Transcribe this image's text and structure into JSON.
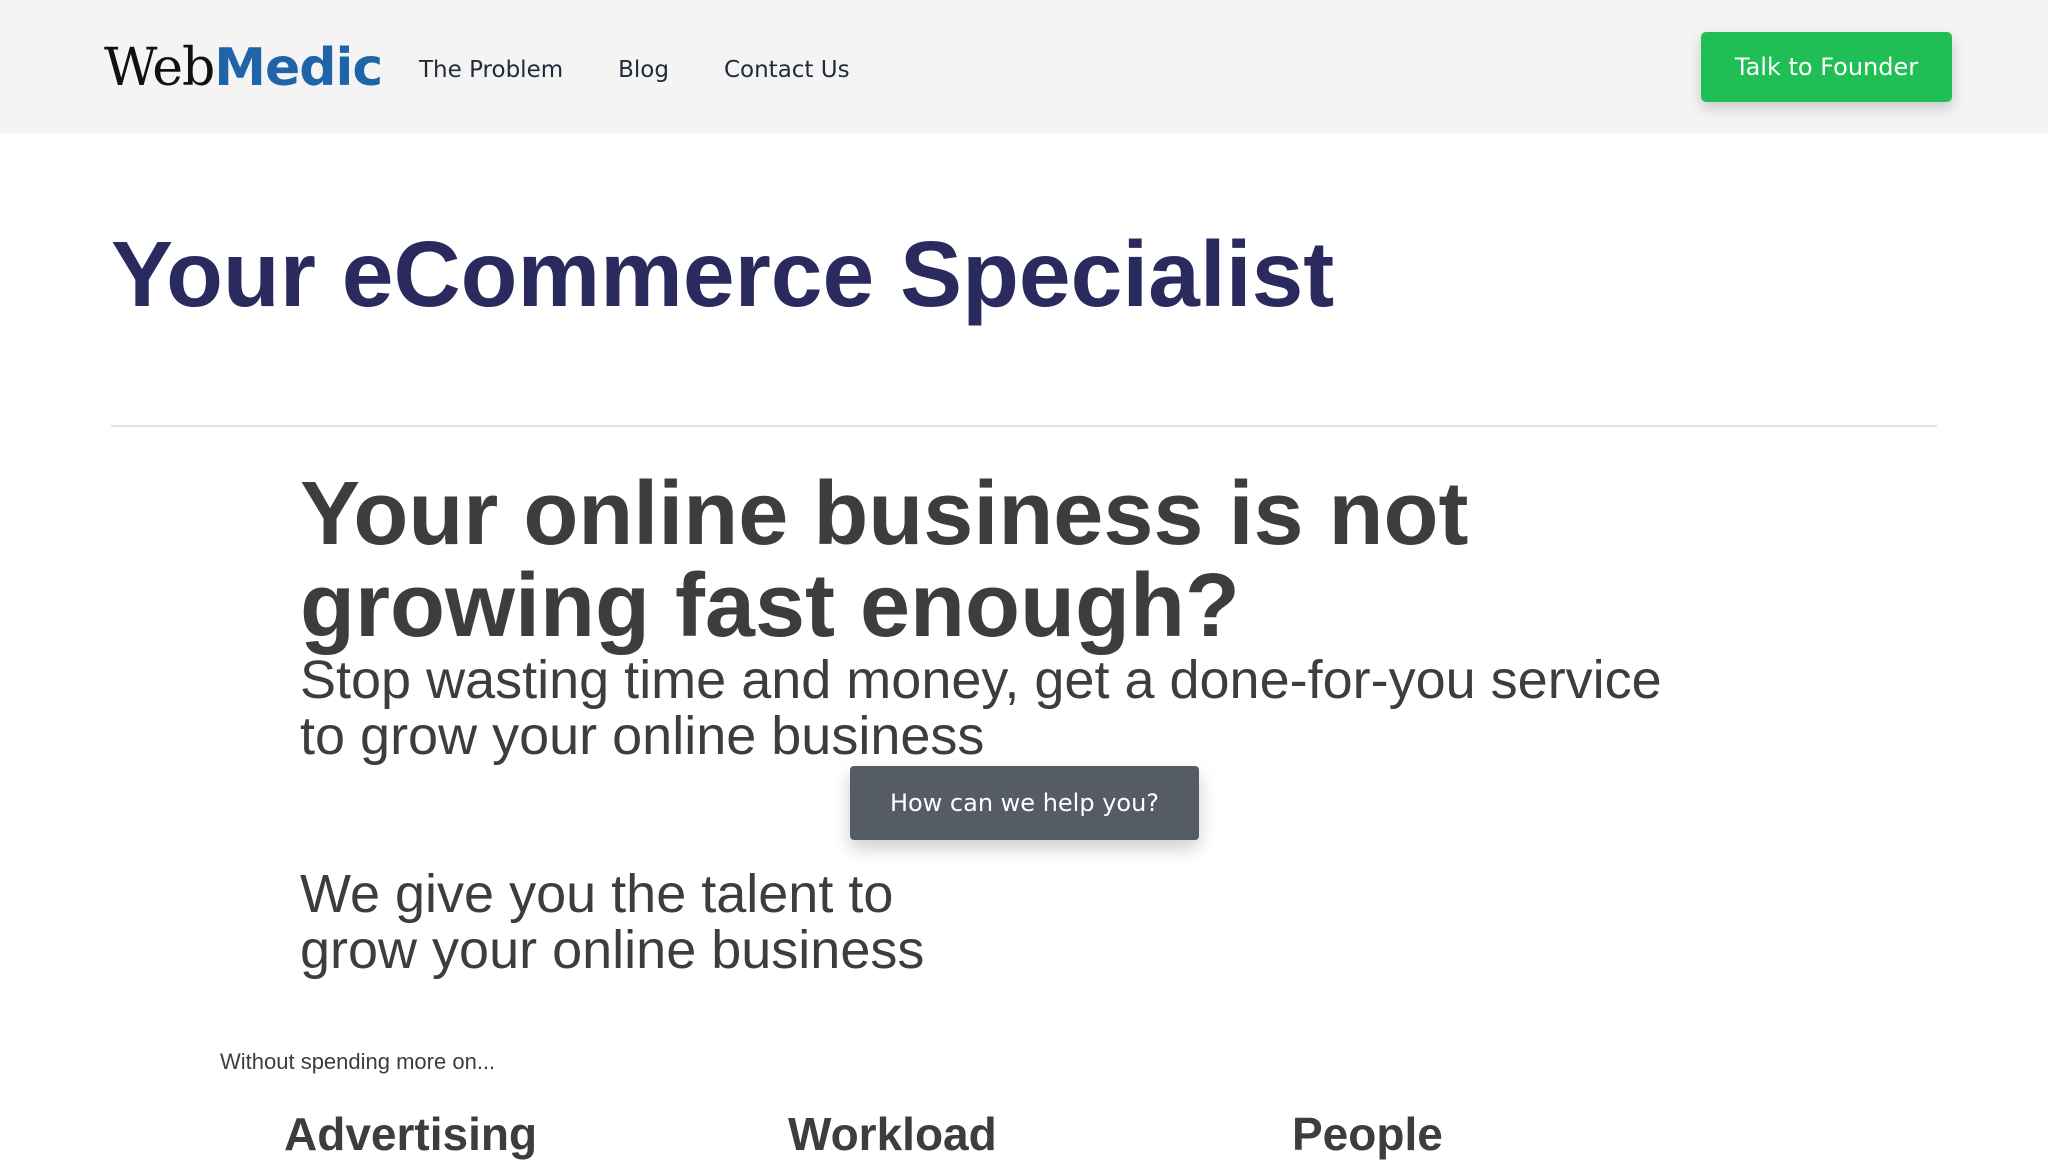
{
  "header": {
    "logo_part1": "Web",
    "logo_part2": "Medic",
    "nav": [
      {
        "label": "The Problem"
      },
      {
        "label": "Blog"
      },
      {
        "label": "Contact Us"
      }
    ],
    "cta_label": "Talk to Founder"
  },
  "hero": {
    "title": "Your eCommerce Specialist"
  },
  "problem": {
    "heading": "Your online business is not growing fast enough?",
    "subheading": "Stop wasting time and money, get a done-for-you service to grow your online business",
    "help_button": "How can we help you?"
  },
  "talent": {
    "line1": "We give you the talent to",
    "line2": "grow your online business"
  },
  "without": {
    "label": "Without spending more on...",
    "items": [
      {
        "label": "Advertising"
      },
      {
        "label": "Workload"
      },
      {
        "label": "People"
      }
    ]
  },
  "colors": {
    "header_bg": "#f4f4f4",
    "cta_green": "#1fbf55",
    "logo_blue": "#1f63a8",
    "hero_navy": "#2b2a5e",
    "text_gray": "#3d3d3d",
    "help_button_bg": "#555c66"
  }
}
